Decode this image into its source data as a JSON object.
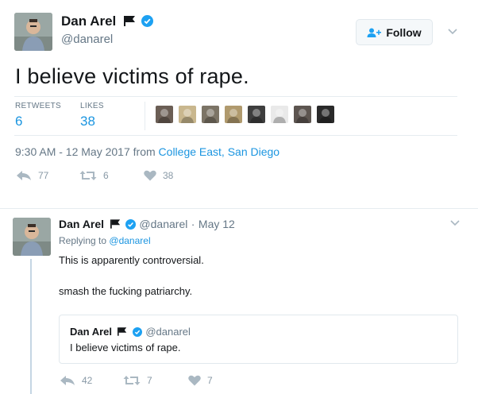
{
  "tweet": {
    "author_name": "Dan Arel",
    "author_handle": "@danarel",
    "follow_label": "Follow",
    "text": "I believe victims of rape.",
    "retweets_label": "RETWEETS",
    "retweets_count": "6",
    "likes_label": "LIKES",
    "likes_count": "38",
    "timestamp": "9:30 AM - 12 May 2017",
    "from_text": "from",
    "location": "College East, San Diego",
    "actions": {
      "reply_count": "77",
      "retweet_count": "6",
      "like_count": "38"
    },
    "likers": [
      {
        "icon": "liker-avatar-1",
        "color": "#6b5e55"
      },
      {
        "icon": "liker-avatar-2",
        "color": "#c9b78e"
      },
      {
        "icon": "liker-avatar-3",
        "color": "#7c7466"
      },
      {
        "icon": "liker-avatar-4",
        "color": "#b09a6e"
      },
      {
        "icon": "liker-avatar-5",
        "color": "#3e3e3e"
      },
      {
        "icon": "liker-avatar-6",
        "color": "#e9e9e9"
      },
      {
        "icon": "liker-avatar-7",
        "color": "#5d5550"
      },
      {
        "icon": "liker-avatar-8",
        "color": "#2a2a2a"
      }
    ]
  },
  "reply": {
    "author_name": "Dan Arel",
    "author_handle": "@danarel",
    "separator": "·",
    "date": "May 12",
    "replying_to_label": "Replying to",
    "replying_to_handle": "@danarel",
    "text_line1": "This is apparently controversial.",
    "text_line2": "smash the fucking patriarchy.",
    "quote": {
      "author_name": "Dan Arel",
      "author_handle": "@danarel",
      "text": "I believe victims of rape."
    },
    "actions": {
      "reply_count": "42",
      "retweet_count": "7",
      "like_count": "7"
    }
  },
  "colors": {
    "accent": "#1b95e0",
    "verified": "#1da1f2",
    "muted": "#657786",
    "action_gray": "#8899a6"
  }
}
